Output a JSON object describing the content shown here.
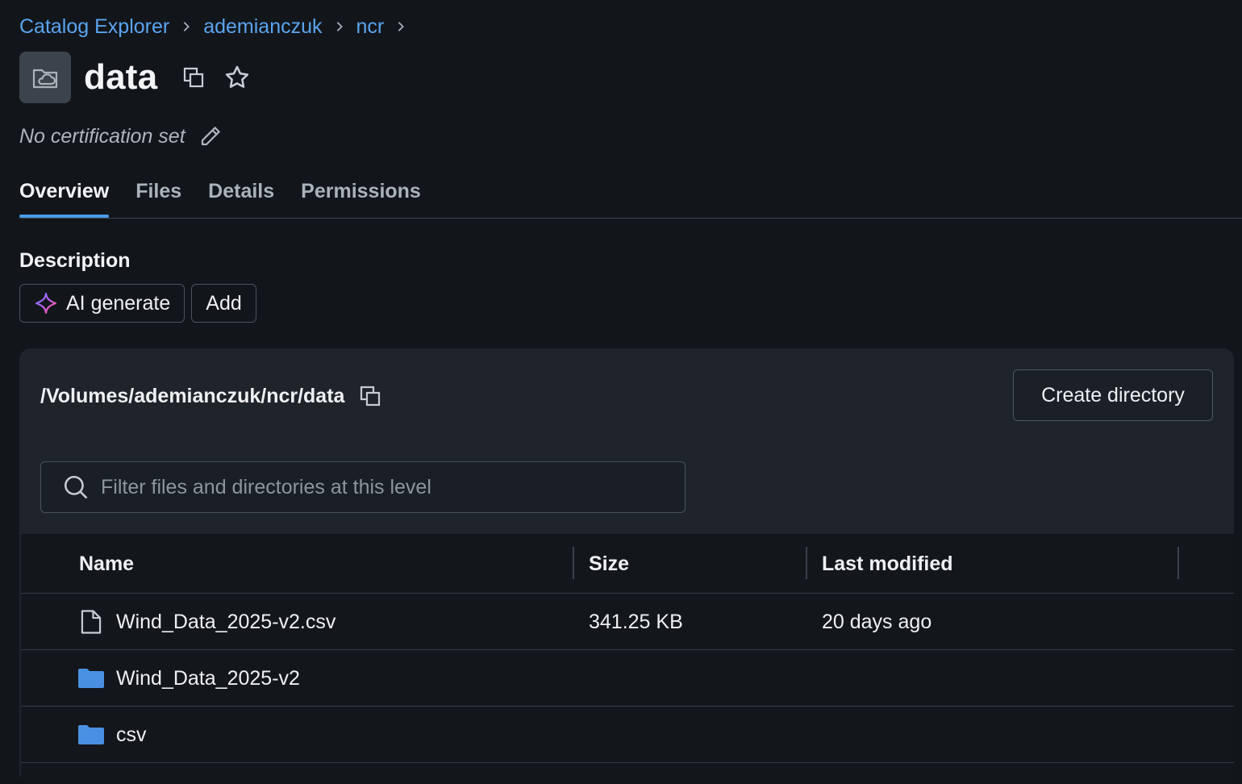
{
  "breadcrumb": {
    "items": [
      "Catalog Explorer",
      "ademianczuk",
      "ncr"
    ]
  },
  "header": {
    "title": "data",
    "icon": "volume-cloud-icon",
    "certification": "No certification set"
  },
  "tabs": [
    {
      "label": "Overview",
      "active": true
    },
    {
      "label": "Files",
      "active": false
    },
    {
      "label": "Details",
      "active": false
    },
    {
      "label": "Permissions",
      "active": false
    }
  ],
  "description": {
    "heading": "Description",
    "ai_generate_label": "AI generate",
    "add_label": "Add"
  },
  "volume": {
    "path": "/Volumes/ademianczuk/ncr/data",
    "create_directory_label": "Create directory",
    "filter_placeholder": "Filter files and directories at this level"
  },
  "table": {
    "columns": [
      "Name",
      "Size",
      "Last modified"
    ],
    "rows": [
      {
        "type": "file",
        "name": "Wind_Data_2025-v2.csv",
        "size": "341.25 KB",
        "modified": "20 days ago"
      },
      {
        "type": "folder",
        "name": "Wind_Data_2025-v2",
        "size": "",
        "modified": ""
      },
      {
        "type": "folder",
        "name": "csv",
        "size": "",
        "modified": ""
      }
    ]
  },
  "colors": {
    "background": "#12161b",
    "link": "#5ba4ee",
    "tab_indicator": "#4b9be8",
    "folder": "#4a90e2",
    "panel": "#1f242b"
  }
}
